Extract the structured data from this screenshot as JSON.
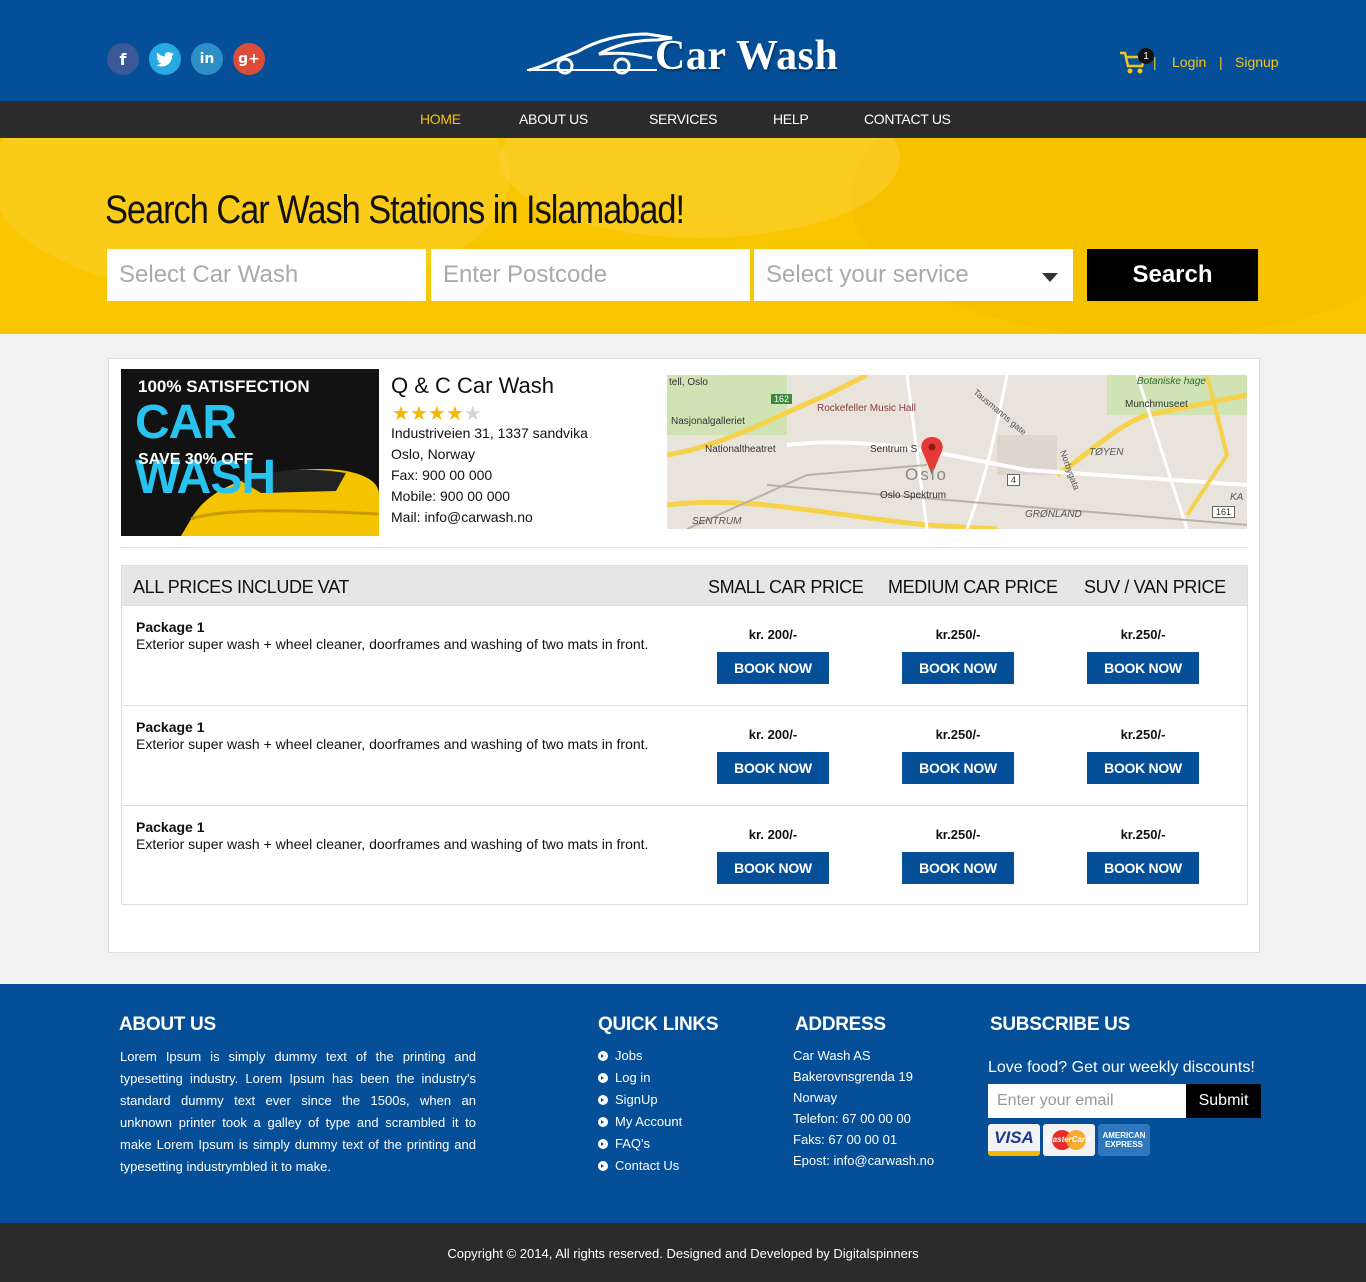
{
  "header": {
    "logo_text": "Car Wash",
    "cart_count": "1",
    "separator": "|",
    "login_label": "Login",
    "signup_label": "Signup",
    "social": [
      "facebook-icon",
      "twitter-icon",
      "linkedin-icon",
      "google-plus-icon"
    ],
    "social_glyphs": {
      "facebook": "f",
      "linkedin": "in",
      "google": "g+"
    }
  },
  "nav": {
    "items": [
      "HOME",
      "ABOUT US",
      "SERVICES",
      "HELP",
      "CONTACT US"
    ]
  },
  "hero": {
    "title": "Search Car Wash Stations in Islamabad!",
    "car_wash_placeholder": "Select Car Wash",
    "postcode_placeholder": "Enter Postcode",
    "service_placeholder": "Select your service",
    "search_label": "Search"
  },
  "promo": {
    "line1": "100% SATISFECTION",
    "line2": "CAR WASH",
    "line3": "SAVE 30% OFF"
  },
  "business": {
    "name": "Q & C Car Wash",
    "rating": 4,
    "rating_max": 5,
    "address1": "Industriveien 31, 1337 sandvika",
    "address2": "Oslo, Norway",
    "fax": "Fax: 900 00 000",
    "mobile": "Mobile: 900 00 000",
    "mail": "Mail: info@carwash.no"
  },
  "map": {
    "labels": [
      "tell, Oslo",
      "Botaniske hage",
      "Nasjonalgalleriet",
      "Rockefeller Music Hall",
      "Munchmuseet",
      "Nationaltheatret",
      "Sentrum S",
      "TØYEN",
      "Oslo",
      "Oslo Spektrum",
      "SENTRUM",
      "GRØNLAND",
      "Tausmanns gate",
      "Norbygata",
      "162",
      "4",
      "161",
      "KA"
    ]
  },
  "prices": {
    "headers": [
      "ALL PRICES INCLUDE VAT",
      "SMALL CAR PRICE",
      "MEDIUM CAR PRICE",
      "SUV / VAN PRICE"
    ],
    "book_label": "BOOK NOW",
    "rows": [
      {
        "title": "Package 1",
        "desc": "Exterior super wash + wheel cleaner, doorframes and washing of two mats in front.",
        "small": "kr. 200/-",
        "medium": "kr.250/-",
        "suv": "kr.250/-"
      },
      {
        "title": "Package 1",
        "desc": "Exterior super wash + wheel cleaner, doorframes and washing of two mats in front.",
        "small": "kr. 200/-",
        "medium": "kr.250/-",
        "suv": "kr.250/-"
      },
      {
        "title": "Package 1",
        "desc": "Exterior super wash + wheel cleaner, doorframes and washing of two mats in front.",
        "small": "kr. 200/-",
        "medium": "kr.250/-",
        "suv": "kr.250/-"
      }
    ]
  },
  "footer": {
    "about_title": "ABOUT US",
    "about_text": "Lorem Ipsum is simply dummy text of the printing and typesetting industry. Lorem Ipsum has been the industry's standard dummy text ever since the 1500s, when an unknown printer took a galley of type and scrambled it to make Lorem Ipsum is simply dummy text of the printing and typesetting industrymbled it to make.",
    "links_title": "QUICK LINKS",
    "links": [
      "Jobs",
      "Log in",
      "SignUp",
      "My Account",
      "FAQ's",
      "Contact Us"
    ],
    "address_title": "ADDRESS",
    "address": [
      "Car Wash AS",
      "Bakerovnsgrenda 19",
      "Norway",
      "Telefon: 67 00 00 00",
      "Faks: 67 00 00 01",
      "Epost: info@carwash.no"
    ],
    "subscribe_title": "SUBSCRIBE US",
    "subscribe_text": "Love food? Get our weekly discounts!",
    "email_placeholder": "Enter your email",
    "submit_label": "Submit",
    "cards": [
      "VISA",
      "MasterCard",
      "AMERICAN",
      "EXPRESS"
    ]
  },
  "copyright": "Copyright © 2014, All rights reserved. Designed and Developed by Digitalspinners",
  "colors": {
    "brand_blue": "#044f97",
    "accent_yellow": "#f9c600",
    "nav_dark": "#2b2b2b"
  }
}
